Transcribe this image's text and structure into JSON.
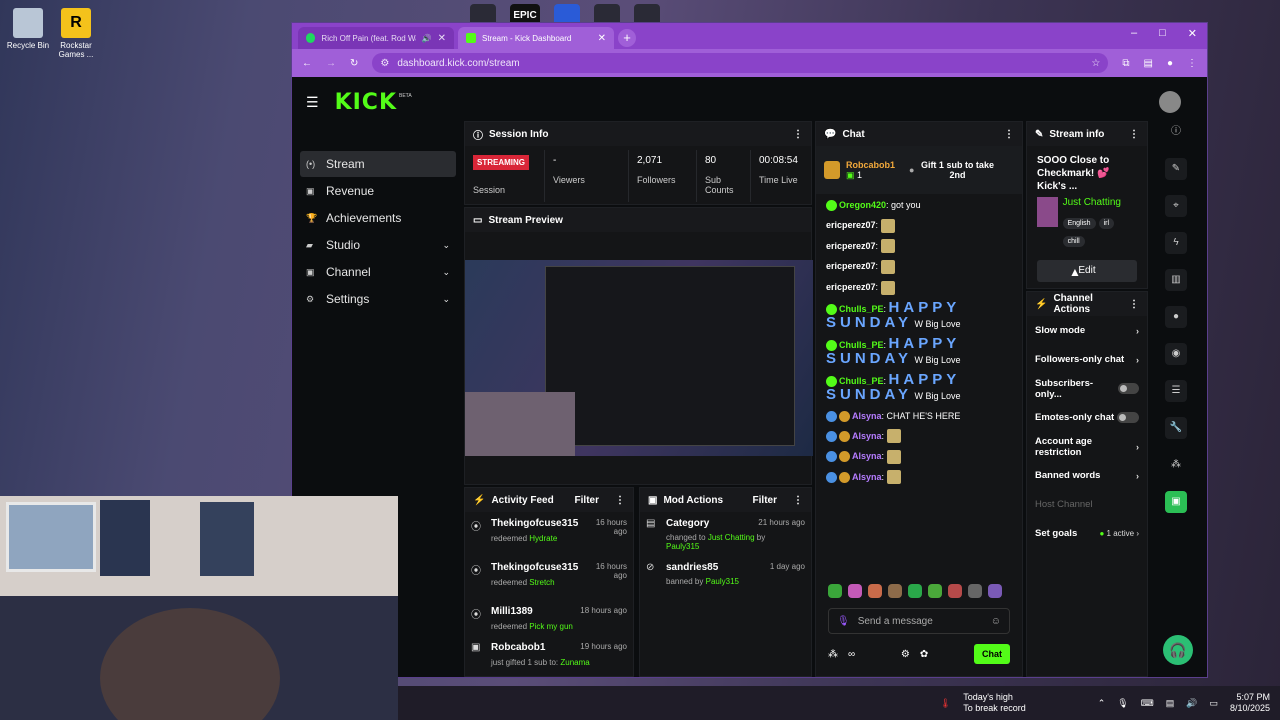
{
  "desktop": {
    "icons": [
      {
        "label": "Recycle Bin"
      },
      {
        "label": "Rockstar Games ..."
      }
    ],
    "top_icon_text": "EPIC"
  },
  "browser": {
    "tabs": [
      {
        "title": "Rich Off Pain (feat. Rod Wa"
      },
      {
        "title": "Stream - Kick Dashboard"
      }
    ],
    "url": "dashboard.kick.com/stream",
    "new_tab": "+",
    "win_min": "–",
    "win_max": "□",
    "win_close": "✕"
  },
  "kick": {
    "logo": "KICK",
    "beta": "BETA"
  },
  "nav": [
    {
      "label": "Stream",
      "icon": "(•)"
    },
    {
      "label": "Revenue",
      "icon": "▣"
    },
    {
      "label": "Achievements",
      "icon": "🏆"
    },
    {
      "label": "Studio",
      "icon": "▰"
    },
    {
      "label": "Channel",
      "icon": "▣"
    },
    {
      "label": "Settings",
      "icon": "⚙"
    }
  ],
  "session": {
    "title": "Session Info",
    "badge": "STREAMING",
    "session_label": "Session",
    "stats": [
      {
        "value": "-",
        "label": "Viewers"
      },
      {
        "value": "2,071",
        "label": "Followers"
      },
      {
        "value": "80",
        "label": "Sub Counts"
      },
      {
        "value": "00:08:54",
        "label": "Time Live"
      }
    ]
  },
  "preview": {
    "title": "Stream Preview"
  },
  "activity": {
    "title": "Activity Feed",
    "filter": "Filter",
    "items": [
      {
        "name": "Thekingofcuse315",
        "action": "redeemed",
        "target": "Hydrate",
        "time": "16 hours ago"
      },
      {
        "name": "Thekingofcuse315",
        "action": "redeemed",
        "target": "Stretch",
        "time": "16 hours ago"
      },
      {
        "name": "Milli1389",
        "action": "redeemed",
        "target": "Pick my gun",
        "time": "18 hours ago"
      },
      {
        "name": "Robcabob1",
        "action": "just gifted 1 sub to:",
        "target": "Zunama",
        "time": "19 hours ago"
      }
    ]
  },
  "modactions": {
    "title": "Mod Actions",
    "filter": "Filter",
    "items": [
      {
        "name": "Category",
        "action": "changed to",
        "target": "Just Chatting",
        "by": "by",
        "mod": "Pauly315",
        "time": "21 hours ago"
      },
      {
        "name": "sandries85",
        "action": "banned by",
        "target": "",
        "by": "",
        "mod": "Pauly315",
        "time": "1 day ago"
      }
    ]
  },
  "chat": {
    "title": "Chat",
    "pinned": {
      "user": "Robcabob1",
      "count": "1",
      "text": "Gift 1 sub to take 2nd"
    },
    "messages": [
      {
        "user": "Oregon420",
        "text": "got you",
        "color": "#53fc18"
      },
      {
        "user": "ericperez07",
        "text": "",
        "color": "#ffffff"
      },
      {
        "user": "ericperez07",
        "text": "",
        "color": "#ffffff"
      },
      {
        "user": "ericperez07",
        "text": "",
        "color": "#ffffff"
      },
      {
        "user": "ericperez07",
        "text": "",
        "color": "#ffffff"
      },
      {
        "user": "Chulls_PE",
        "text": "HAPPY SUNDAY",
        "tail": "W Big Love",
        "color": "#53fc18"
      },
      {
        "user": "Chulls_PE",
        "text": "HAPPY SUNDAY",
        "tail": "W Big Love",
        "color": "#53fc18"
      },
      {
        "user": "Chulls_PE",
        "text": "HAPPY SUNDAY",
        "tail": "W Big Love",
        "color": "#53fc18"
      },
      {
        "user": "Alsyna",
        "text": "CHAT HE'S HERE",
        "color": "#b57cff"
      },
      {
        "user": "Alsyna",
        "text": "",
        "color": "#b57cff"
      },
      {
        "user": "Alsyna",
        "text": "",
        "color": "#b57cff"
      },
      {
        "user": "Alsyna",
        "text": "",
        "color": "#b57cff"
      },
      {
        "user": "Alsyna",
        "text": "",
        "color": "#b57cff"
      },
      {
        "user": "Alsyna",
        "text": "",
        "color": "#b57cff"
      }
    ],
    "placeholder": "Send a message",
    "send": "Chat"
  },
  "streaminfo": {
    "title": "Stream info",
    "stream_title": "SOOO Close to Checkmark! 💕 Kick's ...",
    "category": "Just Chatting",
    "tags": [
      "English",
      "irl",
      "chill"
    ],
    "edit": "Edit"
  },
  "channelactions": {
    "title": "Channel Actions",
    "items": [
      {
        "label": "Slow mode",
        "kind": "chevron"
      },
      {
        "label": "Followers-only chat",
        "kind": "chevron"
      },
      {
        "label": "Subscribers-only...",
        "kind": "toggle"
      },
      {
        "label": "Emotes-only chat",
        "kind": "toggle"
      },
      {
        "label": "Account age restriction",
        "kind": "chevron"
      },
      {
        "label": "Banned words",
        "kind": "chevron"
      },
      {
        "label": "Host Channel",
        "kind": "disabled"
      },
      {
        "label": "Set goals",
        "kind": "goals",
        "extra": "1 active"
      }
    ]
  },
  "taskbar": {
    "weather": "Today's high",
    "weather_sub": "To break record",
    "time": "5:07 PM",
    "date": "8/10/2025"
  },
  "colors": {
    "accent": "#53fc18",
    "tabbar": "#8a43c9",
    "live": "#d92638"
  }
}
